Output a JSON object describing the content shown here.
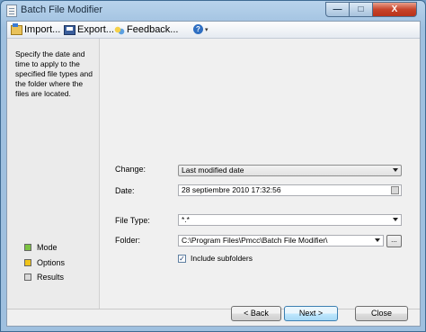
{
  "window": {
    "title": "Batch File Modifier",
    "min": "—",
    "max": "□",
    "close": "X"
  },
  "toolbar": {
    "import": "Import...",
    "export": "Export...",
    "feedback": "Feedback...",
    "help": "?",
    "help_arrow": "▾"
  },
  "left": {
    "description": "Specify the date and time to apply to the specified file types and the folder where the files are located.",
    "steps": [
      {
        "label": "Mode",
        "color": "#7cc242"
      },
      {
        "label": "Options",
        "color": "#f0c419"
      },
      {
        "label": "Results",
        "color": "#d9d9d9"
      }
    ]
  },
  "form": {
    "change_label": "Change:",
    "change_value": "Last modified date",
    "date_label": "Date:",
    "date_value": "28 septiembre 2010 17:32:56",
    "filetype_label": "File Type:",
    "filetype_value": "*.*",
    "folder_label": "Folder:",
    "folder_value": "C:\\Program Files\\Pmcc\\Batch File Modifier\\",
    "browse_label": "...",
    "include_subfolders_label": "Include subfolders",
    "include_subfolders_mark": "✓",
    "include_subfolders_checked": true
  },
  "buttons": {
    "back": "< Back",
    "next": "Next >",
    "close": "Close"
  }
}
